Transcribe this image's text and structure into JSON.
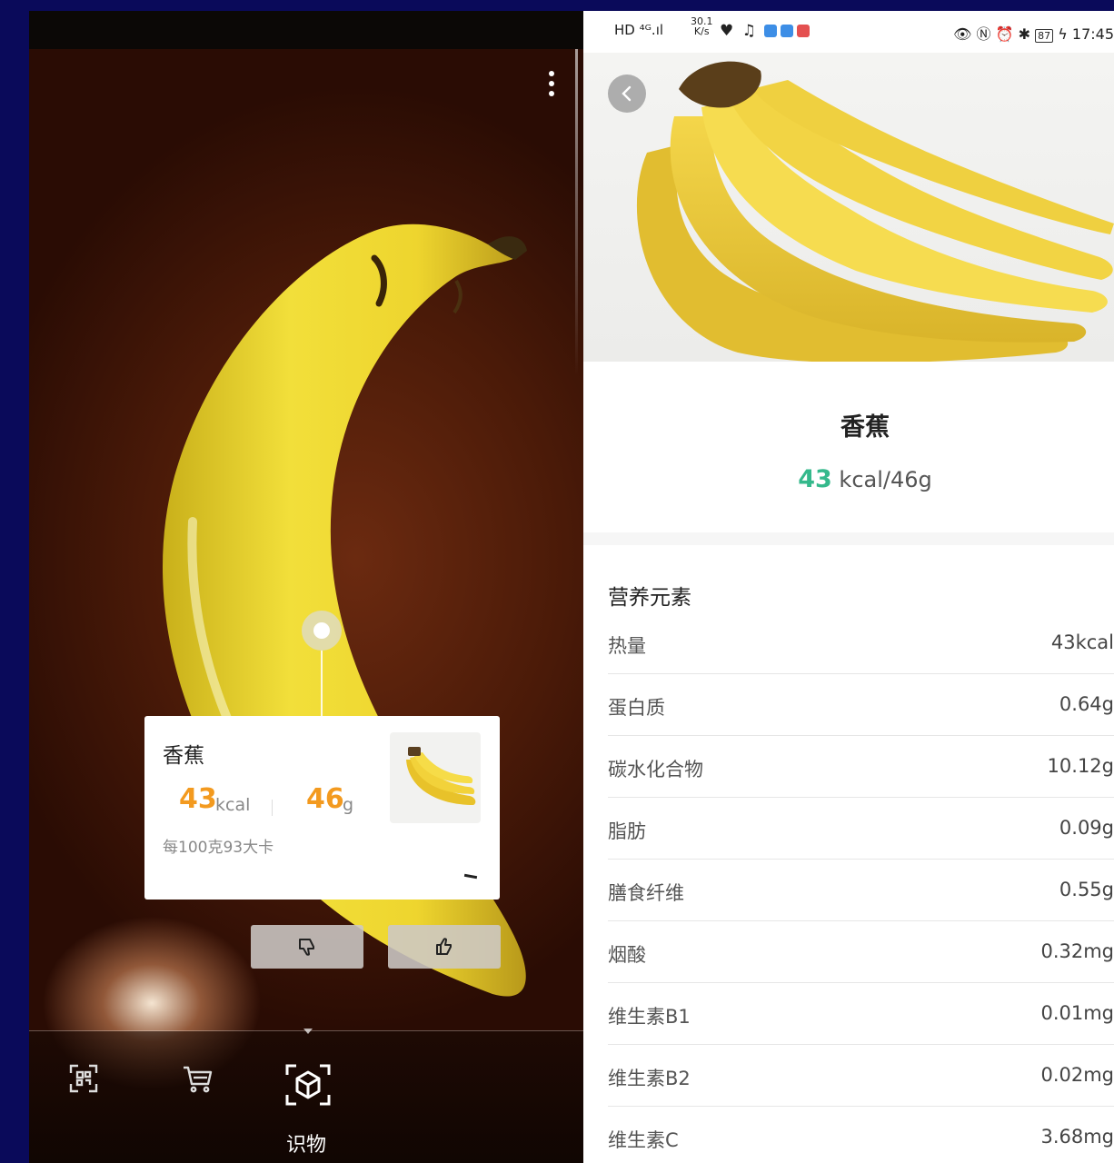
{
  "left": {
    "result_card": {
      "name": "香蕉",
      "kcal_value": "43",
      "kcal_unit": "kcal",
      "weight_value": "46",
      "weight_unit": "g",
      "per_100g": "每100克93大卡"
    },
    "bottom_tabs": [
      {
        "icon": "scan-icon"
      },
      {
        "icon": "cart-icon"
      },
      {
        "icon": "object-recognition-icon",
        "label": "识物",
        "active": true
      }
    ],
    "feedback": {
      "dislike_icon": "thumbs-down-icon",
      "like_icon": "thumbs-up-icon"
    },
    "colors": {
      "accent": "#f39a1f"
    }
  },
  "right": {
    "status_bar": {
      "left_text": "HD ⁴ᴳ.ıl",
      "speed_value": "30.1",
      "speed_unit": "K/s",
      "time": "17:45",
      "battery": "87"
    },
    "title": "香蕉",
    "calorie_value": "43",
    "calorie_rest": " kcal/46g",
    "nutrition_heading": "营养元素",
    "nutrients": [
      {
        "name": "热量",
        "value": "43kcal"
      },
      {
        "name": "蛋白质",
        "value": "0.64g"
      },
      {
        "name": "碳水化合物",
        "value": "10.12g"
      },
      {
        "name": "脂肪",
        "value": "0.09g"
      },
      {
        "name": "膳食纤维",
        "value": "0.55g"
      },
      {
        "name": "烟酸",
        "value": "0.32mg"
      },
      {
        "name": "维生素B1",
        "value": "0.01mg"
      },
      {
        "name": "维生素B2",
        "value": "0.02mg"
      },
      {
        "name": "维生素C",
        "value": "3.68mg"
      }
    ],
    "colors": {
      "accent": "#35b98c"
    }
  }
}
